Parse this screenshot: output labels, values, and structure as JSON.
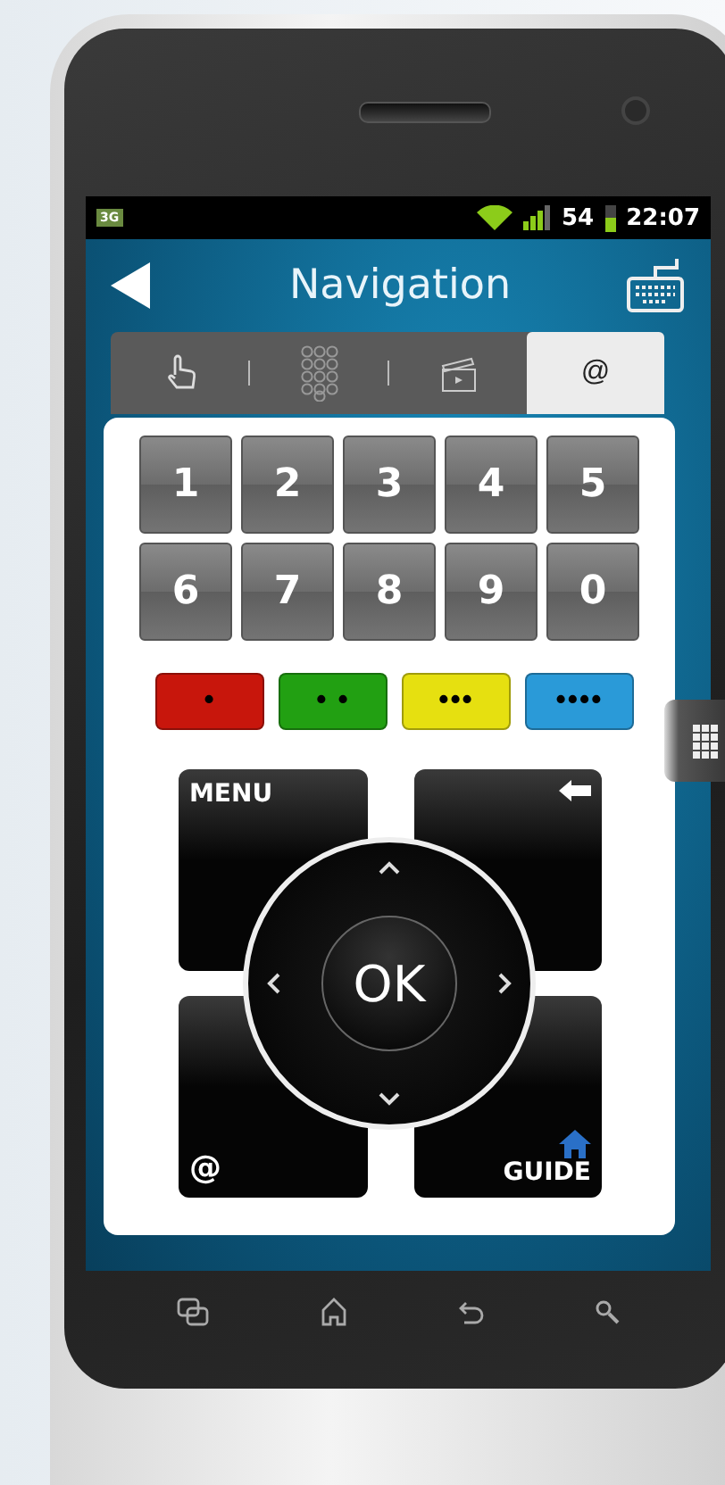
{
  "status_bar": {
    "network": "3G",
    "battery": "54",
    "time": "22:07"
  },
  "title": "Navigation",
  "tabs": [
    {
      "kind": "touch",
      "selected": false
    },
    {
      "kind": "keypad",
      "selected": false
    },
    {
      "kind": "media",
      "selected": false
    },
    {
      "kind": "text",
      "label": "@",
      "selected": true
    }
  ],
  "number_keys": [
    "1",
    "2",
    "3",
    "4",
    "5",
    "6",
    "7",
    "8",
    "9",
    "0"
  ],
  "color_keys": [
    {
      "label": "•",
      "color": "#c8160c"
    },
    {
      "label": "• •",
      "color": "#22a012"
    },
    {
      "label": "•••",
      "color": "#e6e010"
    },
    {
      "label": "••••",
      "color": "#2a9ad8"
    }
  ],
  "dpad": {
    "menu": "MENU",
    "guide": "GUIDE",
    "at": "@",
    "ok": "OK"
  }
}
